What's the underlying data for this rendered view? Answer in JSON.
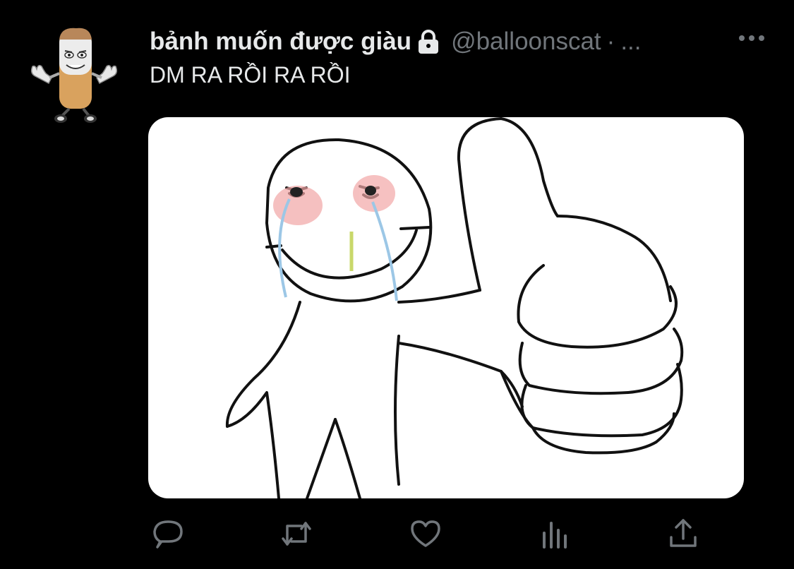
{
  "tweet": {
    "display_name": "bảnh muốn được giàu",
    "handle": "@balloonscat",
    "separator": "·",
    "time": "...",
    "text": "DM RA RỒI RA RỒI"
  },
  "icons": {
    "avatar": "cartoon-mascot-avatar",
    "verified_lock": "lock-icon",
    "more": "more-horizontal-icon",
    "reply": "reply-icon",
    "retweet": "retweet-icon",
    "like": "heart-icon",
    "analytics": "analytics-icon",
    "share": "share-icon"
  },
  "colors": {
    "background": "#000000",
    "primary_text": "#e7e9ea",
    "secondary_text": "#71767b",
    "icon": "#71767b",
    "media_bg": "#ffffff"
  }
}
